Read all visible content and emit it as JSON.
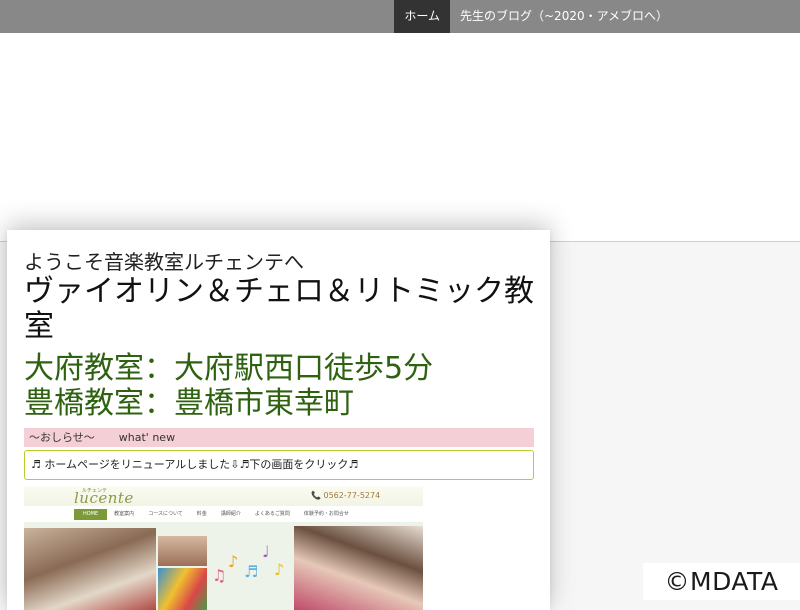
{
  "nav": {
    "items": [
      {
        "label": "ホーム",
        "active": true
      },
      {
        "label": "先生のブログ（~2020・アメブロへ）",
        "active": false
      }
    ]
  },
  "card": {
    "welcome": "ようこそ音楽教室ルチェンテへ",
    "title": "ヴァイオリン＆チェロ＆リトミック教室",
    "location_1": "大府教室：大府駅西口徒歩5分",
    "location_2": "豊橋教室：豊橋市東幸町",
    "news": {
      "label": "～おしらせ～",
      "label_en": "what' new"
    },
    "notice": "♬ ホームページをリニューアルしました⇩♬下の画面をクリック♬"
  },
  "preview": {
    "logo": "lucente",
    "logo_kana": "ルチェンテ",
    "phone": "📞 0562-77-5274",
    "menu": [
      "HOME",
      "教室案内",
      "コースについて",
      "料金",
      "講師紹介",
      "よくあるご質問",
      "体験予約・お問合せ"
    ],
    "notes_colors": [
      "#e05a8a",
      "#f0a020",
      "#5ab0e0",
      "#9a60c0",
      "#e8c020"
    ]
  },
  "watermark": "©MDATA",
  "colors": {
    "nav_bg": "#888888",
    "nav_active": "#333333",
    "location_green": "#2e6110",
    "news_pink": "#f4cfd6",
    "notice_border": "#b9cc2c"
  }
}
